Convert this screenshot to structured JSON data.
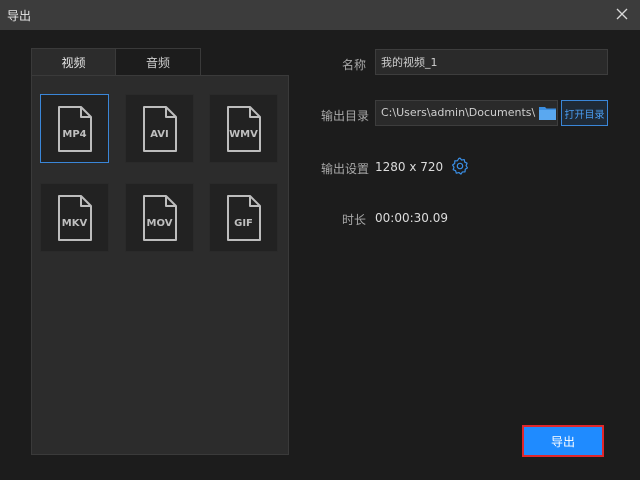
{
  "window": {
    "title": "导出"
  },
  "tabs": [
    {
      "label": "视频",
      "active": true
    },
    {
      "label": "音频",
      "active": false
    }
  ],
  "formats": [
    {
      "label": "MP4",
      "selected": true
    },
    {
      "label": "AVI",
      "selected": false
    },
    {
      "label": "WMV",
      "selected": false
    },
    {
      "label": "MKV",
      "selected": false
    },
    {
      "label": "MOV",
      "selected": false
    },
    {
      "label": "GIF",
      "selected": false
    }
  ],
  "fields": {
    "name_label": "名称",
    "name_value": "我的视频_1",
    "dir_label": "输出目录",
    "dir_value": "C:\\Users\\admin\\Documents\\",
    "open_dir_label": "打开目录",
    "settings_label": "输出设置",
    "settings_value": "1280 x 720",
    "duration_label": "时长",
    "duration_value": "00:00:30.09"
  },
  "export_label": "导出",
  "colors": {
    "accent": "#1f8bff",
    "selected_border": "#3a86d8",
    "highlight_border": "#e0262b"
  }
}
